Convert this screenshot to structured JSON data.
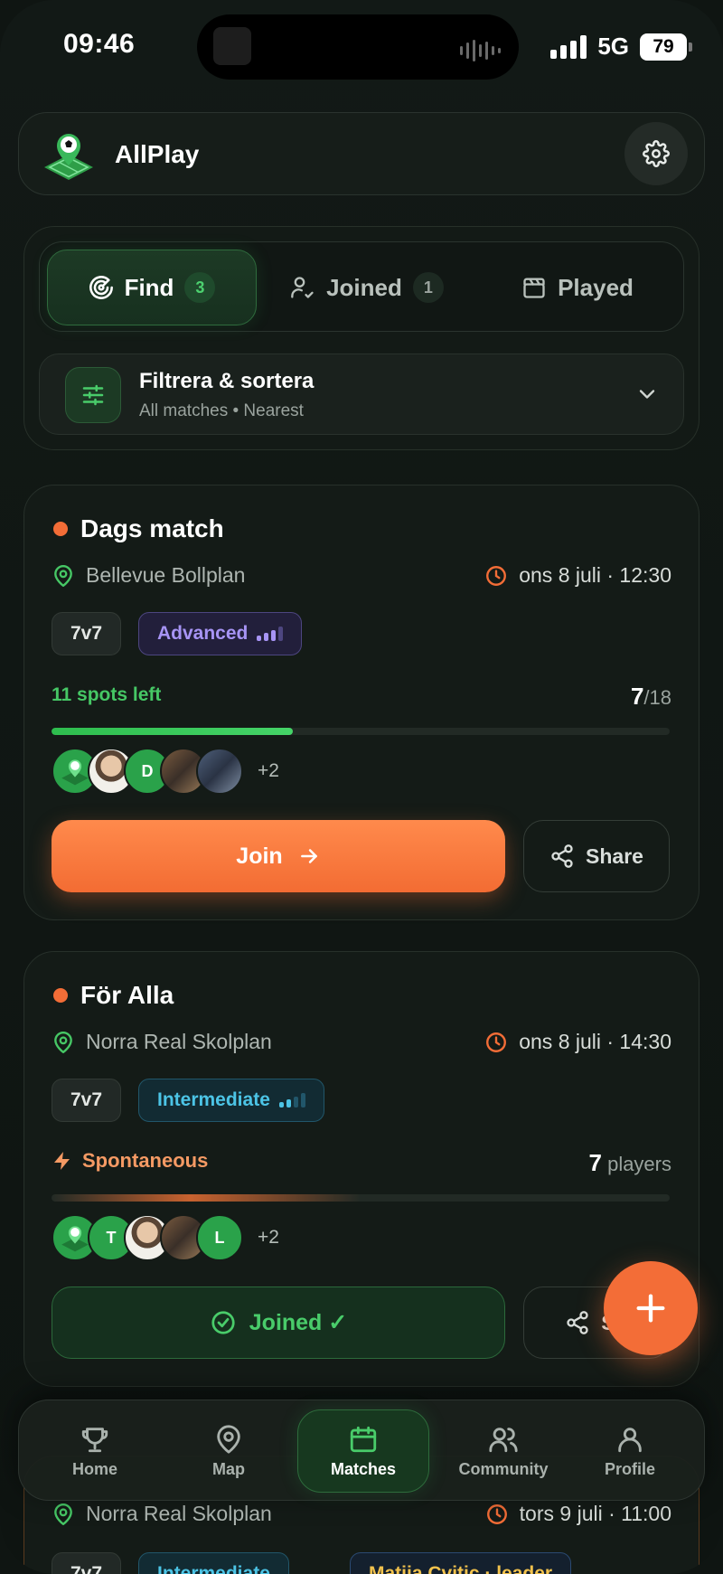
{
  "status_bar": {
    "time": "09:46",
    "network": "5G",
    "battery": "79"
  },
  "header": {
    "app_name": "AllPlay",
    "logo_icon": "soccer-pin-icon",
    "settings_icon": "gear-icon"
  },
  "tabs": [
    {
      "label": "Find",
      "count": "3",
      "icon": "radar-icon",
      "active": true
    },
    {
      "label": "Joined",
      "count": "1",
      "icon": "user-check-icon",
      "active": false
    },
    {
      "label": "Played",
      "icon": "clapperboard-icon",
      "active": false
    }
  ],
  "filter": {
    "title": "Filtrera & sortera",
    "subtitle": "All matches • Nearest"
  },
  "matches": [
    {
      "title": "Dags match",
      "venue": "Bellevue Bollplan",
      "datetime": "ons 8 juli · 12:30",
      "format": "7v7",
      "level": "Advanced",
      "spots_left": "11 spots left",
      "joined_count": "7",
      "capacity": "/18",
      "fill_fraction": 0.39,
      "avatar_letters": [
        "D"
      ],
      "more": "+2",
      "action": "Join",
      "share": "Share"
    },
    {
      "title": "För Alla",
      "venue": "Norra Real Skolplan",
      "datetime": "ons 8 juli · 14:30",
      "format": "7v7",
      "level": "Intermediate",
      "type": "Spontaneous",
      "player_count": "7",
      "players_label": "players",
      "avatar_letters": [
        "T",
        "L"
      ],
      "more": "+2",
      "action": "Joined ✓",
      "share": "Sh"
    },
    {
      "venue": "Norra Real Skolplan",
      "datetime": "tors 9 juli · 11:00",
      "format": "7v7",
      "level": "Intermediate",
      "leader": "Matija Cvitic · leader"
    }
  ],
  "bottom_nav": [
    {
      "label": "Home",
      "icon": "trophy-icon",
      "active": false
    },
    {
      "label": "Map",
      "icon": "map-pin-icon",
      "active": false
    },
    {
      "label": "Matches",
      "icon": "calendar-icon",
      "active": true
    },
    {
      "label": "Community",
      "icon": "users-icon",
      "active": false
    },
    {
      "label": "Profile",
      "icon": "user-icon",
      "active": false
    }
  ],
  "colors": {
    "accent_orange": "#f36d37",
    "accent_green": "#46c765",
    "advanced_purple": "#a794f5",
    "intermediate_cyan": "#4cc4e6"
  }
}
